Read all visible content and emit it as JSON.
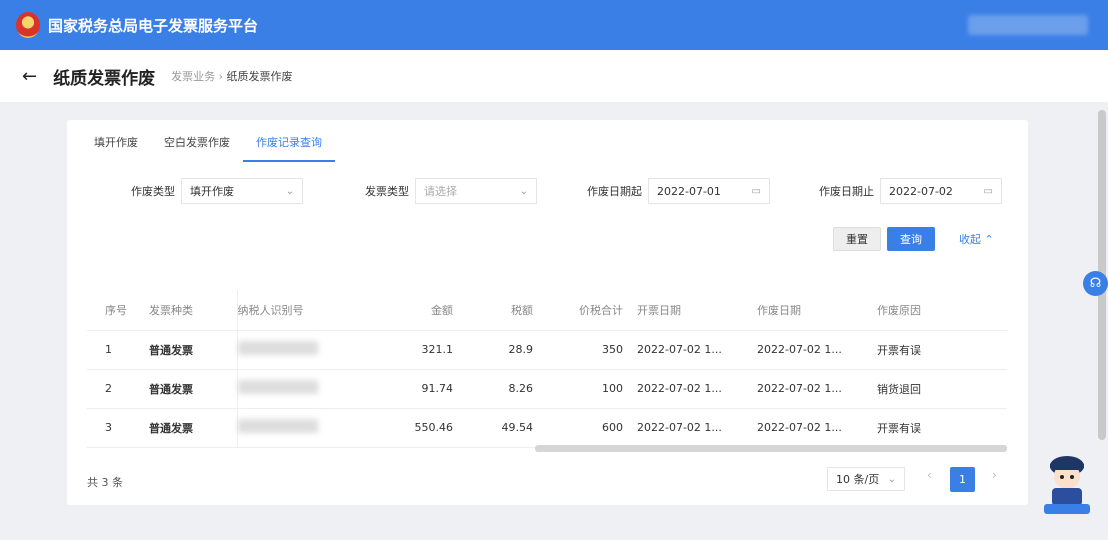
{
  "header": {
    "title": "国家税务总局电子发票服务平台"
  },
  "page": {
    "back_icon": "←",
    "title": "纸质发票作废",
    "breadcrumb": [
      "发票业务",
      "纸质发票作废"
    ],
    "breadcrumb_sep": "›"
  },
  "tabs": [
    {
      "label": "填开作废"
    },
    {
      "label": "空白发票作废"
    },
    {
      "label": "作废记录查询"
    }
  ],
  "filters": {
    "void_type": {
      "label": "作废类型",
      "value": "填开作废"
    },
    "invoice_type": {
      "label": "发票类型",
      "placeholder": "请选择"
    },
    "date_from": {
      "label": "作废日期起",
      "value": "2022-07-01"
    },
    "date_to": {
      "label": "作废日期止",
      "value": "2022-07-02"
    }
  },
  "buttons": {
    "reset": "重置",
    "query": "查询",
    "collapse": "收起"
  },
  "table": {
    "headers": [
      "序号",
      "发票种类",
      "纳税人识别号",
      "金额",
      "税额",
      "价税合计",
      "开票日期",
      "作废日期",
      "作废原因"
    ],
    "rows": [
      [
        "1",
        "普通发票",
        "",
        "321.1",
        "28.9",
        "350",
        "2022-07-02 1...",
        "2022-07-02 1...",
        "开票有误"
      ],
      [
        "2",
        "普通发票",
        "",
        "91.74",
        "8.26",
        "100",
        "2022-07-02 1...",
        "2022-07-02 1...",
        "销货退回"
      ],
      [
        "3",
        "普通发票",
        "",
        "550.46",
        "49.54",
        "600",
        "2022-07-02 1...",
        "2022-07-02 1...",
        "开票有误"
      ]
    ]
  },
  "footer": {
    "total": "共 3 条",
    "page_size": "10 条/页",
    "current_page": "1",
    "prev": "‹",
    "next": "›"
  },
  "colors": {
    "primary": "#3a7fe6"
  }
}
